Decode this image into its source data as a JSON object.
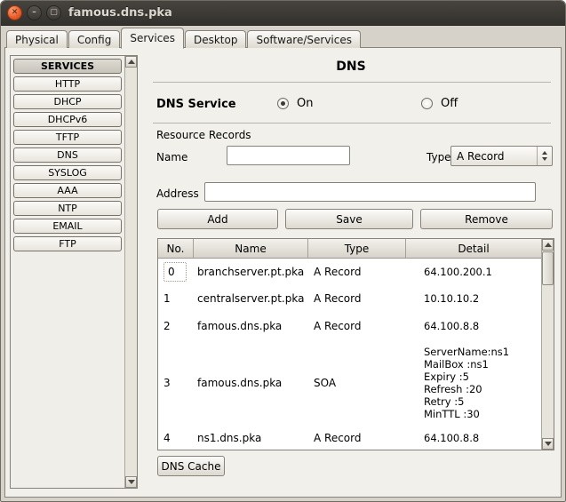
{
  "window": {
    "title": "famous.dns.pka"
  },
  "titlebar_icons": {
    "close": "✕",
    "minimize": "–",
    "maximize": "▢"
  },
  "tabs": [
    {
      "label": "Physical"
    },
    {
      "label": "Config"
    },
    {
      "label": "Services"
    },
    {
      "label": "Desktop"
    },
    {
      "label": "Software/Services"
    }
  ],
  "active_tab": "Services",
  "sidebar": {
    "header": "SERVICES",
    "items": [
      "HTTP",
      "DHCP",
      "DHCPv6",
      "TFTP",
      "DNS",
      "SYSLOG",
      "AAA",
      "NTP",
      "EMAIL",
      "FTP"
    ]
  },
  "main": {
    "title": "DNS",
    "dns_service": {
      "label": "DNS Service",
      "on": "On",
      "off": "Off",
      "selected": "On"
    },
    "resource_records_label": "Resource Records",
    "name_field": {
      "label": "Name",
      "value": ""
    },
    "type_field": {
      "label": "Type",
      "value": "A Record"
    },
    "address_field": {
      "label": "Address",
      "value": ""
    },
    "buttons": {
      "add": "Add",
      "save": "Save",
      "remove": "Remove",
      "dns_cache": "DNS Cache"
    },
    "table": {
      "headers": [
        "No.",
        "Name",
        "Type",
        "Detail"
      ],
      "rows": [
        {
          "no": "0",
          "name": "branchserver.pt.pka",
          "type": "A Record",
          "detail": "64.100.200.1"
        },
        {
          "no": "1",
          "name": "centralserver.pt.pka",
          "type": "A Record",
          "detail": "10.10.10.2"
        },
        {
          "no": "2",
          "name": "famous.dns.pka",
          "type": "A Record",
          "detail": "64.100.8.8"
        },
        {
          "no": "3",
          "name": "famous.dns.pka",
          "type": "SOA",
          "detail": "ServerName:ns1\nMailBox :ns1\nExpiry :5\nRefresh :20\nRetry :5\nMinTTL :30"
        },
        {
          "no": "4",
          "name": "ns1.dns.pka",
          "type": "A Record",
          "detail": "64.100.8.8"
        }
      ]
    }
  },
  "colors": {
    "accent_close": "#EA5E2D",
    "titlebar": "#3C3A36",
    "panel": "#F2F0EA"
  }
}
